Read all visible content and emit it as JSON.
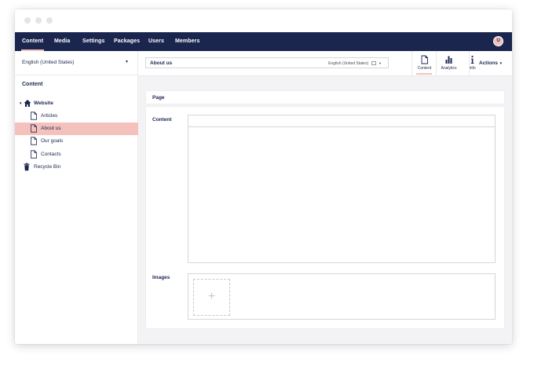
{
  "nav": {
    "items": [
      {
        "label": "Content"
      },
      {
        "label": "Media"
      },
      {
        "label": "Settings"
      },
      {
        "label": "Packages"
      },
      {
        "label": "Users"
      },
      {
        "label": "Members"
      }
    ],
    "avatar_initial": "U"
  },
  "sidebar": {
    "language": "English (United States)",
    "section_title": "Content",
    "tree": [
      {
        "label": "Website",
        "icon": "home-icon"
      },
      {
        "label": "Articles",
        "icon": "document-icon"
      },
      {
        "label": "About us",
        "icon": "document-icon"
      },
      {
        "label": "Our goals",
        "icon": "document-icon"
      },
      {
        "label": "Contacts",
        "icon": "document-icon"
      },
      {
        "label": "Recycle Bin",
        "icon": "trash-icon"
      }
    ]
  },
  "editor": {
    "node_name": "About us",
    "culture": "English (United States)",
    "tabs": [
      {
        "label": "Content",
        "icon": "document-icon"
      },
      {
        "label": "Analytics",
        "icon": "bar-chart-icon"
      },
      {
        "label": "Info",
        "icon": "info-icon"
      }
    ],
    "actions_label": "Actions",
    "group_title": "Page",
    "properties": {
      "content_label": "Content",
      "images_label": "Images",
      "add_symbol": "+"
    }
  },
  "colors": {
    "nav_bg": "#1b264f",
    "accent": "#f5c1bc",
    "text": "#1b264f"
  }
}
